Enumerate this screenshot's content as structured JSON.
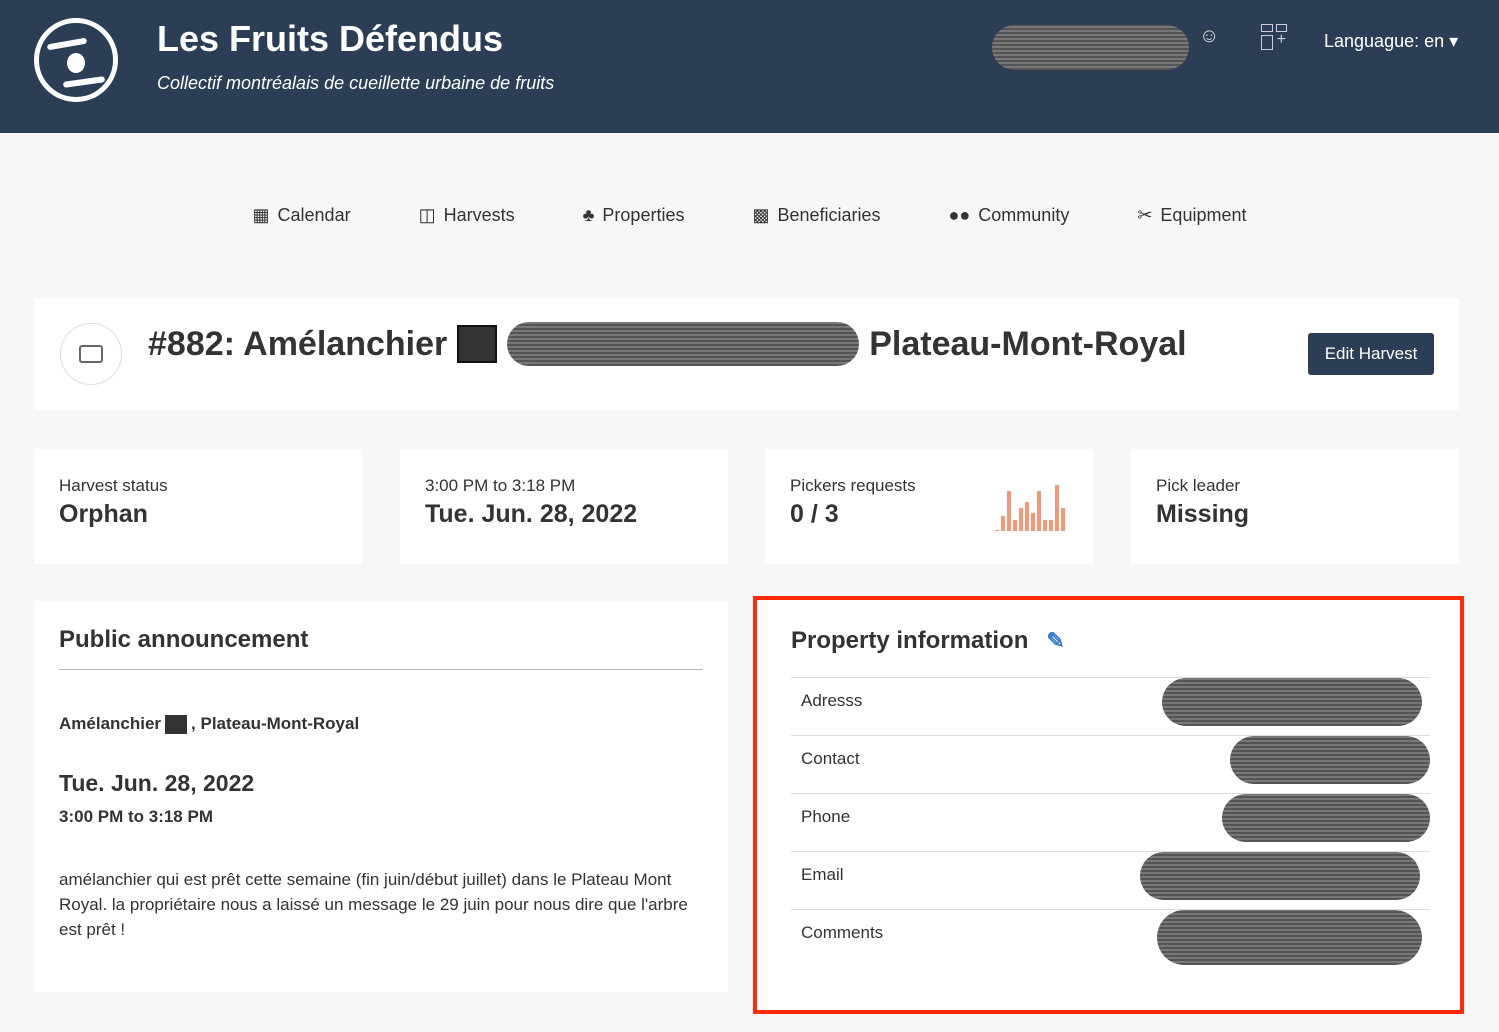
{
  "header": {
    "brand": "Les Fruits Défendus",
    "tagline": "Collectif montréalais de cueillette urbaine de fruits",
    "language": "Languague: en"
  },
  "nav": [
    {
      "label": "Calendar",
      "icon": "calendar-icon"
    },
    {
      "label": "Harvests",
      "icon": "basket-icon"
    },
    {
      "label": "Properties",
      "icon": "tree-icon"
    },
    {
      "label": "Beneficiaries",
      "icon": "gift-icon"
    },
    {
      "label": "Community",
      "icon": "users-icon"
    },
    {
      "label": "Equipment",
      "icon": "scissors-icon"
    }
  ],
  "harvest": {
    "title_prefix": "#882: Amélanchier",
    "title_suffix": "Plateau-Mont-Royal",
    "edit_label": "Edit Harvest"
  },
  "stats": [
    {
      "label": "Harvest status",
      "value": "Orphan"
    },
    {
      "label": "3:00 PM to 3:18 PM",
      "value": "Tue. Jun. 28, 2022"
    },
    {
      "label": "Pickers requests",
      "value": "0 / 3"
    },
    {
      "label": "Pick leader",
      "value": "Missing"
    }
  ],
  "pickers_sparkline": [
    1,
    15,
    39,
    11,
    23,
    28,
    18,
    39,
    11,
    11,
    45,
    23
  ],
  "announcement": {
    "title": "Public announcement",
    "location_tree": "Amélanchier",
    "location_area": ", Plateau-Mont-Royal",
    "date": "Tue. Jun. 28, 2022",
    "time": "3:00 PM to 3:18 PM",
    "description": "amélanchier qui est prêt cette semaine (fin juin/début juillet) dans le Plateau Mont Royal. la propriétaire nous a laissé un message le 29 juin pour nous dire que l'arbre est prêt !"
  },
  "property": {
    "title": "Property information",
    "rows": [
      "Adresss",
      "Contact",
      "Phone",
      "Email",
      "Comments"
    ]
  },
  "colors": {
    "header": "#2c3e55",
    "highlight": "#ff2a0c",
    "spark": "#f69878"
  }
}
